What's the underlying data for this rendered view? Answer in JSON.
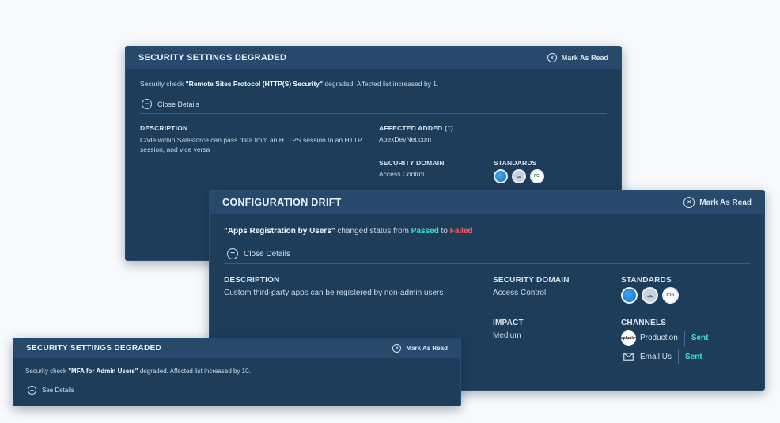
{
  "card1": {
    "title": "SECURITY SETTINGS DEGRADED",
    "mark_read": "Mark As Read",
    "message_prefix": "Security check",
    "message_item": "\"Remote Sites Protocol (HTTP(S) Security\"",
    "message_suffix": "degraded. Affected list increased by 1.",
    "details_toggle": "Close Details",
    "description_label": "DESCRIPTION",
    "description_text": "Code within Salesforce can pass data from an HTTPS session to an HTTP session, and vice versa",
    "affected_label": "AFFECTED ADDED (1)",
    "affected_value": "ApexDevNet.com",
    "domain_label": "SECURITY DOMAIN",
    "domain_value": "Access Control",
    "standards_label": "STANDARDS",
    "standards": [
      "globe-badge",
      "cloud-badge",
      "pci-badge"
    ],
    "pci_text": "PCI"
  },
  "card2": {
    "title": "CONFIGURATION DRIFT",
    "mark_read": "Mark As Read",
    "message_item": "\"Apps Registration by Users\"",
    "message_middle": "changed status from",
    "status_from": "Passed",
    "message_to": "to",
    "status_to": "Failed",
    "details_toggle": "Close Details",
    "description_label": "DESCRIPTION",
    "description_text": "Custom third-party apps can be registered by non-admin users",
    "domain_label": "SECURITY DOMAIN",
    "domain_value": "Access Control",
    "standards_label": "STANDARDS",
    "cis_text": "CIS",
    "impact_label": "IMPACT",
    "impact_value": "Medium",
    "channels_label": "CHANNELS",
    "channels": [
      {
        "name": "Production",
        "status": "Sent",
        "icon": "splunk-icon",
        "logo_text": "splunk>"
      },
      {
        "name": "Email Us",
        "status": "Sent",
        "icon": "envelope-icon"
      }
    ]
  },
  "card3": {
    "title": "SECURITY SETTINGS DEGRADED",
    "mark_read": "Mark As Read",
    "message_prefix": "Security check",
    "message_item": "\"MFA for Admin Users\"",
    "message_suffix": "degraded. Affected list increased by 10.",
    "details_toggle": "See Details"
  },
  "colors": {
    "panel_bg": "#1e3d5b",
    "header_bg": "#27496c",
    "passed": "#3fe0c5",
    "failed": "#ff5a5f",
    "sent": "#3fe0c5"
  }
}
